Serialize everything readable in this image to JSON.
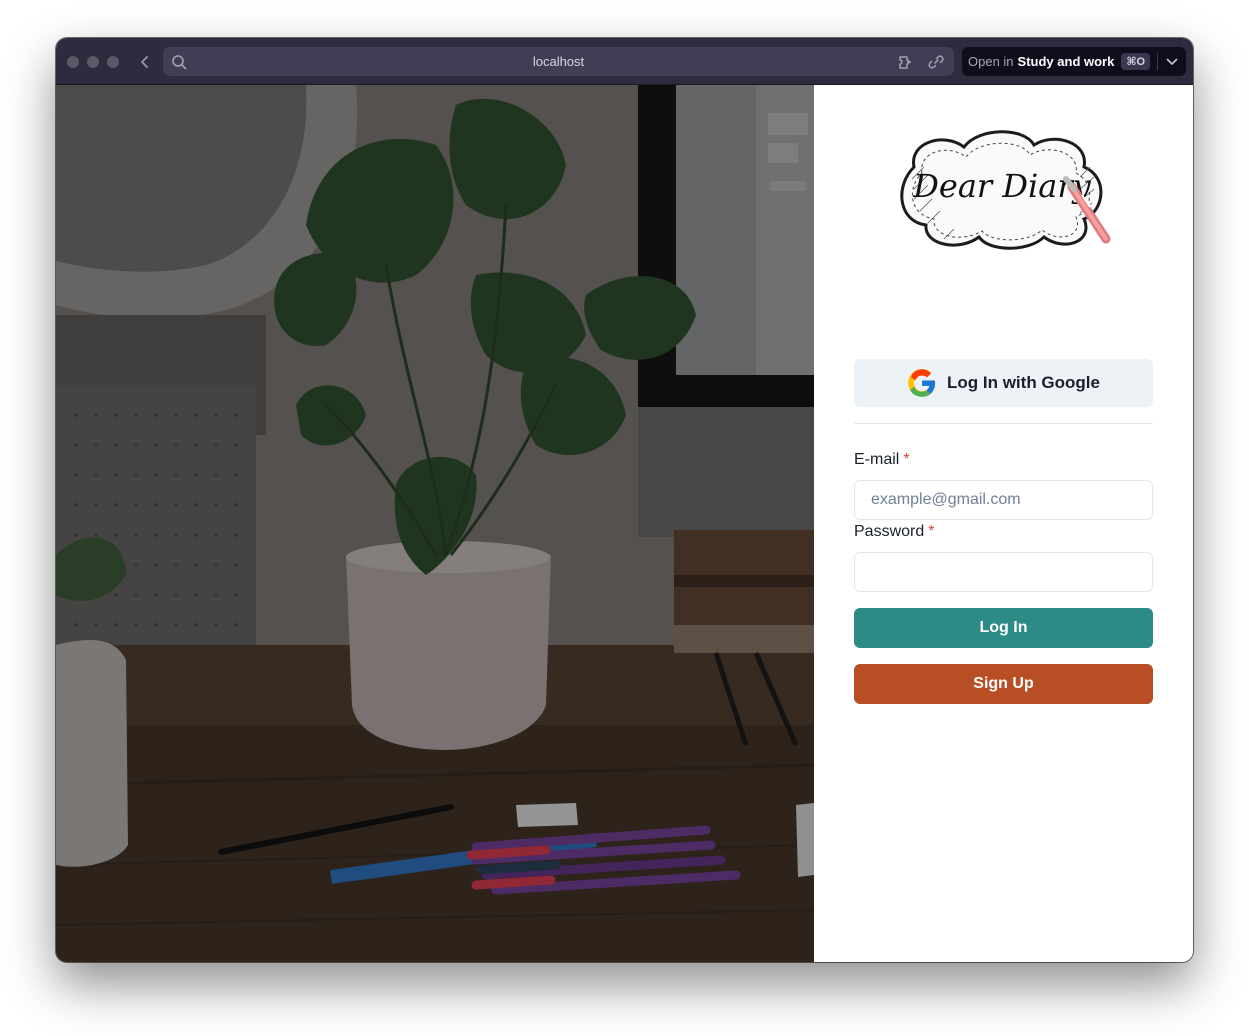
{
  "browser": {
    "url": "localhost",
    "open_in": {
      "prefix": "Open in",
      "target": "Study and work",
      "shortcut": "⌘O"
    },
    "icons": [
      "close-icon",
      "minimize-icon",
      "maximize-icon",
      "back-arrow-icon",
      "search-icon",
      "extension-icon",
      "link-icon",
      "chevron-down-icon"
    ]
  },
  "hero_image": {
    "description_icon": "desk-plant-photo",
    "overlay_color": "#000000"
  },
  "login": {
    "logo_text": "Dear Diary",
    "google_button": "Log In with Google",
    "email": {
      "label": "E-mail",
      "required_mark": "*",
      "placeholder": "example@gmail.com",
      "value": ""
    },
    "password": {
      "label": "Password",
      "required_mark": "*",
      "value": ""
    },
    "login_button": "Log In",
    "signup_button": "Sign Up"
  },
  "colors": {
    "titlebar": "#2f2b3f",
    "login_button": "#2c8a87",
    "signup_button": "#b84f24",
    "google_button_bg": "#edf2f7",
    "required": "#e53e3e"
  }
}
